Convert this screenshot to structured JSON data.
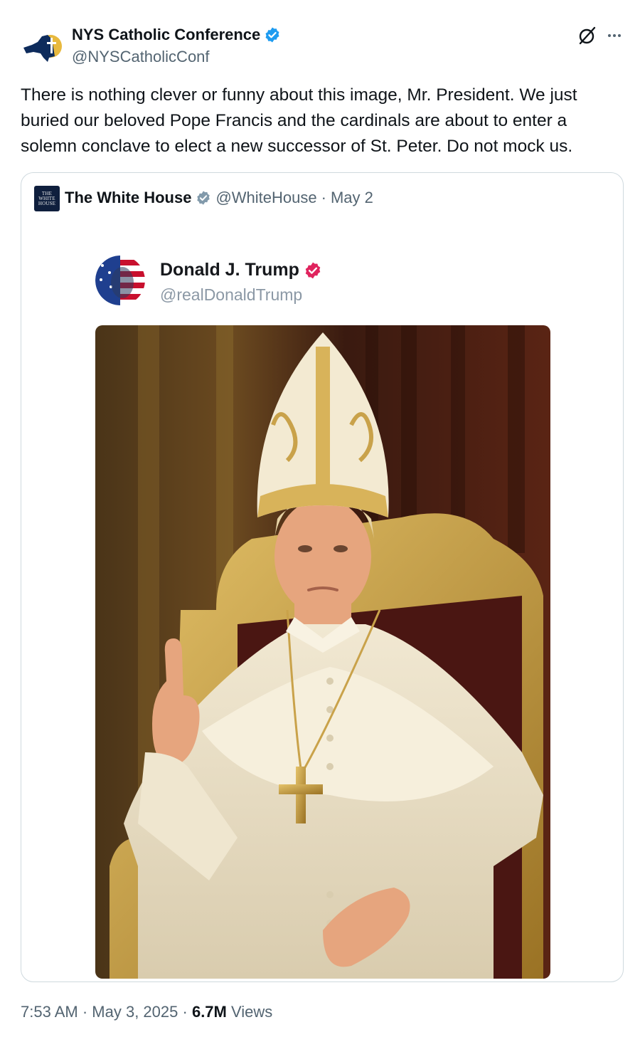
{
  "tweet": {
    "author_name": "NYS Catholic Conference",
    "author_handle": "@NYSCatholicConf",
    "text": "There is nothing clever or funny about this image, Mr. President. We just buried our beloved Pope Francis and the cardinals are about to enter a solemn conclave to elect a new successor of St. Peter. Do not mock us.",
    "time": "7:53 AM",
    "date": "May 3, 2025",
    "views_count": "6.7M",
    "views_label": "Views",
    "separator": "·"
  },
  "quoted": {
    "author_name": "The White House",
    "author_handle": "@WhiteHouse",
    "date": "May 2",
    "avatar_text": "THE WHITE HOUSE",
    "embedded": {
      "author_name": "Donald J. Trump",
      "author_handle": "@realDonaldTrump"
    }
  },
  "icons": {
    "verified_main": "verified-badge-icon",
    "verified_quote": "gray-verified-badge-icon",
    "verified_embedded": "pink-verified-badge-icon",
    "grok": "grok-icon",
    "more": "more-icon"
  },
  "colors": {
    "verified_blue": "#1d9bf0",
    "gov_gray": "#829aab",
    "truth_pink": "#e0245e",
    "secondary_text": "#536471",
    "border": "#cfd9de"
  }
}
